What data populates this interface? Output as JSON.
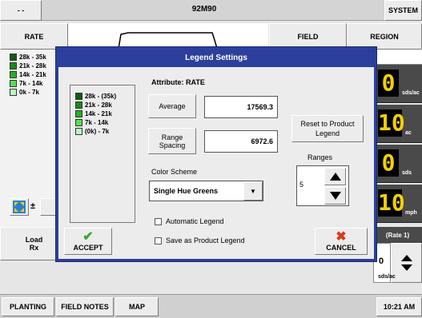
{
  "topbar": {
    "left_button": "- -",
    "title": "92M90",
    "system_button": "SYSTEM"
  },
  "left": {
    "rate_button": "RATE",
    "legend": [
      {
        "label": "28k - 35k",
        "color": "#0f5c0f"
      },
      {
        "label": "21k - 28k",
        "color": "#1a8a1a"
      },
      {
        "label": "14k - 21k",
        "color": "#22b322"
      },
      {
        "label": "7k - 14k",
        "color": "#52e052"
      },
      {
        "label": "0k - 7k",
        "color": "#bff5bf"
      }
    ],
    "load_rx_line1": "Load",
    "load_rx_line2": "Rx"
  },
  "right": {
    "field_button": "FIELD",
    "region_button": "REGION",
    "readouts": [
      {
        "value": "0",
        "unit": "sds/ac"
      },
      {
        "value": "10",
        "unit": "ac"
      },
      {
        "value": "0",
        "unit": "sds"
      },
      {
        "value": "10",
        "unit": "mph"
      }
    ],
    "rate1_label": "(Rate 1)",
    "rate_value": "0",
    "rate_unit": "sds/ac"
  },
  "bottom": {
    "tabs": [
      "PLANTING",
      "FIELD NOTES",
      "MAP"
    ],
    "clock": "10:21 AM"
  },
  "dialog": {
    "title": "Legend Settings",
    "legend": [
      {
        "label": "28k - (35k)",
        "color": "#0f5c0f"
      },
      {
        "label": "21k - 28k",
        "color": "#1a8a1a"
      },
      {
        "label": "14k - 21k",
        "color": "#22b322"
      },
      {
        "label": "7k - 14k",
        "color": "#52e052"
      },
      {
        "label": "(0k) - 7k",
        "color": "#bff5bf"
      }
    ],
    "attribute_label": "Attribute: RATE",
    "average_button": "Average",
    "average_value": "17569.3",
    "range_spacing_line1": "Range",
    "range_spacing_line2": "Spacing",
    "range_spacing_value": "6972.6",
    "color_scheme_label": "Color Scheme",
    "color_scheme_value": "Single Hue Greens",
    "automatic_legend_label": "Automatic Legend",
    "save_product_label": "Save as Product Legend",
    "reset_line1": "Reset to Product",
    "reset_line2": "Legend",
    "ranges_label": "Ranges",
    "ranges_value": "5",
    "accept_label": "ACCEPT",
    "cancel_label": "CANCEL",
    "accept_color": "#3aa82a",
    "cancel_color": "#d83a1a"
  }
}
